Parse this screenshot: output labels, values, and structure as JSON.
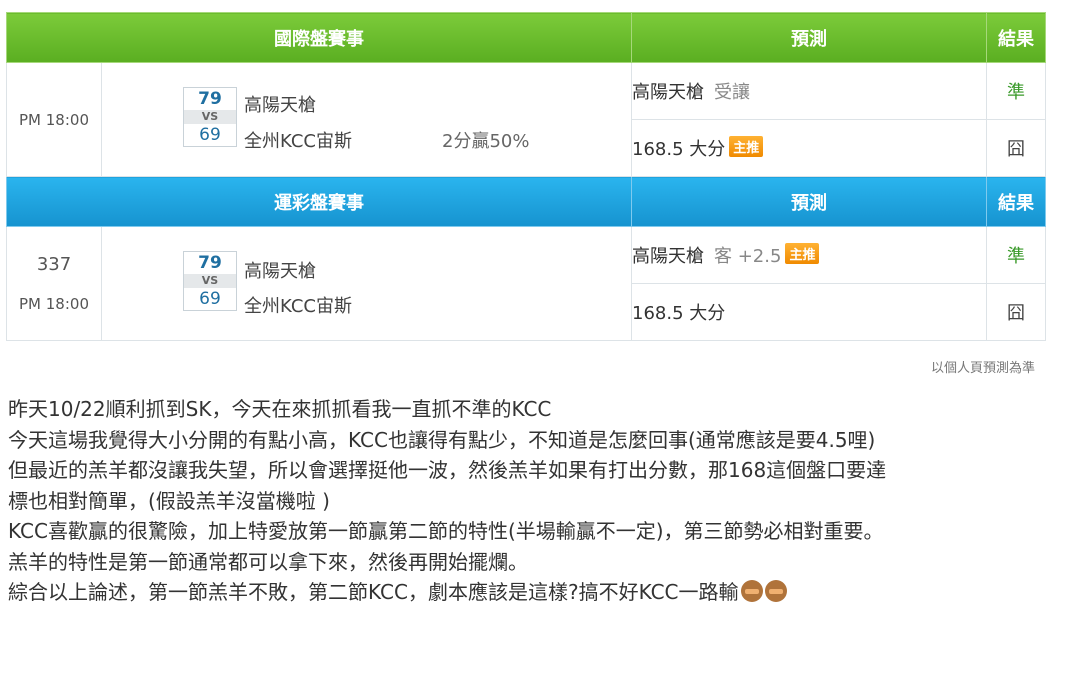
{
  "international": {
    "header": {
      "title": "國際盤賽事",
      "prediction": "預測",
      "result": "結果"
    },
    "time": "PM 18:00",
    "home_score": "79",
    "vs": "VS",
    "away_score": "69",
    "home_team": "高陽天槍",
    "away_team": "全州KCC宙斯",
    "note": "2分贏50%",
    "pred1_team": "高陽天槍",
    "pred1_sub": "受讓",
    "pred1_result": "準",
    "pred2_text": "168.5 大分",
    "pred2_badge": "主推",
    "pred2_result": "囧"
  },
  "lottery": {
    "header": {
      "title": "運彩盤賽事",
      "prediction": "預測",
      "result": "結果"
    },
    "game_no": "337",
    "time": "PM 18:00",
    "home_score": "79",
    "vs": "VS",
    "away_score": "69",
    "home_team": "高陽天槍",
    "away_team": "全州KCC宙斯",
    "pred1_team": "高陽天槍",
    "pred1_sub": "客 +2.5",
    "pred1_badge": "主推",
    "pred1_result": "準",
    "pred2_text": "168.5 大分",
    "pred2_result": "囧"
  },
  "footnote": "以個人頁預測為準",
  "post_lines": [
    "昨天10/22順利抓到SK，今天在來抓抓看我一直抓不準的KCC",
    "今天這場我覺得大小分開的有點小高，KCC也讓得有點少，不知道是怎麼回事(通常應該是要4.5哩)",
    "但最近的羔羊都沒讓我失望，所以會選擇挺他一波，然後羔羊如果有打出分數，那168這個盤口要達",
    "標也相對簡單，(假設羔羊沒當機啦 )",
    "KCC喜歡贏的很驚險，加上特愛放第一節贏第二節的特性(半場輸贏不一定)，第三節勢必相對重要。",
    "羔羊的特性是第一節通常都可以拿下來，然後再開始擺爛。",
    "綜合以上論述，第一節羔羊不敗，第二節KCC，劇本應該是這樣?搞不好KCC一路輸"
  ],
  "emoji_icon": "see-no-evil-monkey-icon"
}
